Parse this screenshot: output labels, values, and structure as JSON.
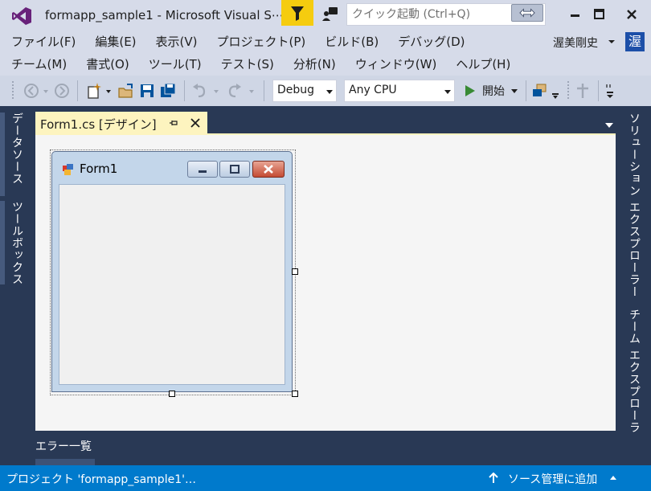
{
  "window": {
    "title": "formapp_sample1 - Microsoft Visual S⋯"
  },
  "quick_launch": {
    "placeholder": "クイック起動 (Ctrl+Q)"
  },
  "menu": {
    "row1": [
      "ファイル(F)",
      "編集(E)",
      "表示(V)",
      "プロジェクト(P)",
      "ビルド(B)",
      "デバッグ(D)"
    ],
    "row2": [
      "チーム(M)",
      "書式(O)",
      "ツール(T)",
      "テスト(S)",
      "分析(N)",
      "ウィンドウ(W)",
      "ヘルプ(H)"
    ]
  },
  "user": {
    "name": "渥美剛史",
    "avatar_text": "渥"
  },
  "toolbar": {
    "config": "Debug",
    "platform": "Any CPU",
    "start_label": "開始"
  },
  "left_panels": [
    "データソース",
    "ツールボックス"
  ],
  "right_panels": [
    "ソリューション エクスプローラー",
    "チーム エクスプローラ"
  ],
  "document_tab": {
    "label": "Form1.cs [デザイン]"
  },
  "form": {
    "title": "Form1"
  },
  "bottom": {
    "error_list": "エラー一覧"
  },
  "status": {
    "left": "プロジェクト 'formapp_sample1'…",
    "right": "ソース管理に追加"
  },
  "colors": {
    "chrome": "#d6dbe9",
    "frame": "#293955",
    "status_bar": "#007acc",
    "active_tab": "#fdf4bf",
    "filter_button": "#f5cc0f"
  }
}
